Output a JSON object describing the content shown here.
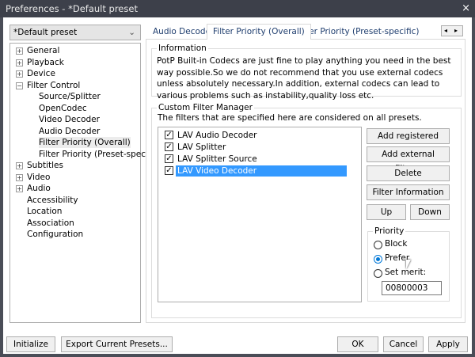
{
  "window": {
    "title": "Preferences - *Default preset",
    "close": "×"
  },
  "preset": {
    "selected": "*Default preset"
  },
  "tree": [
    {
      "label": "General",
      "expander": "+"
    },
    {
      "label": "Playback",
      "expander": "+"
    },
    {
      "label": "Device",
      "expander": "+"
    },
    {
      "label": "Filter Control",
      "expander": "−"
    },
    {
      "label": "Source/Splitter",
      "child": true
    },
    {
      "label": "OpenCodec",
      "child": true
    },
    {
      "label": "Video Decoder",
      "child": true
    },
    {
      "label": "Audio Decoder",
      "child": true
    },
    {
      "label": "Filter Priority (Overall)",
      "child": true,
      "selected": true
    },
    {
      "label": "Filter Priority (Preset-specific)",
      "child": true
    },
    {
      "label": "Subtitles",
      "expander": "+"
    },
    {
      "label": "Video",
      "expander": "+"
    },
    {
      "label": "Audio",
      "expander": "+"
    },
    {
      "label": "Accessibility"
    },
    {
      "label": "Location"
    },
    {
      "label": "Association"
    },
    {
      "label": "Configuration"
    }
  ],
  "tabs": [
    "Audio Decoder",
    "Filter Priority (Overall)",
    "Filter Priority (Preset-specific)"
  ],
  "tab_scroll": {
    "left": "◂",
    "right": "▸"
  },
  "information": {
    "title": "Information",
    "text": "PotP Built-in Codecs are just fine to play anything you need in the best way possible.So we do not recommend that you use external codecs unless absolutely necessary.In addition, external codecs can lead to various problems such as instability,quality loss etc."
  },
  "manager": {
    "title": "Custom Filter Manager",
    "desc": "The filters that are specified here are considered on all presets.",
    "filters": [
      {
        "label": "LAV Audio Decoder",
        "checked": true
      },
      {
        "label": "LAV Splitter",
        "checked": true
      },
      {
        "label": "LAV Splitter Source",
        "checked": true
      },
      {
        "label": "LAV Video Decoder",
        "checked": true,
        "selected": true
      }
    ],
    "check": "✓",
    "buttons": {
      "add_registered": "Add registered filter",
      "add_external": "Add external filter...",
      "delete": "Delete",
      "info": "Filter Information",
      "up": "Up",
      "down": "Down"
    }
  },
  "priority": {
    "title": "Priority",
    "block": "Block",
    "prefer": "Prefer",
    "set_merit": "Set merit:",
    "selected": "Prefer",
    "merit_value": "00800003"
  },
  "footer": {
    "initialize": "Initialize",
    "export": "Export Current Presets...",
    "ok": "OK",
    "cancel": "Cancel",
    "apply": "Apply"
  },
  "colors": {
    "selection": "#3399ff",
    "titlebar": "#3d404a",
    "radio_accent": "#0078d7"
  }
}
